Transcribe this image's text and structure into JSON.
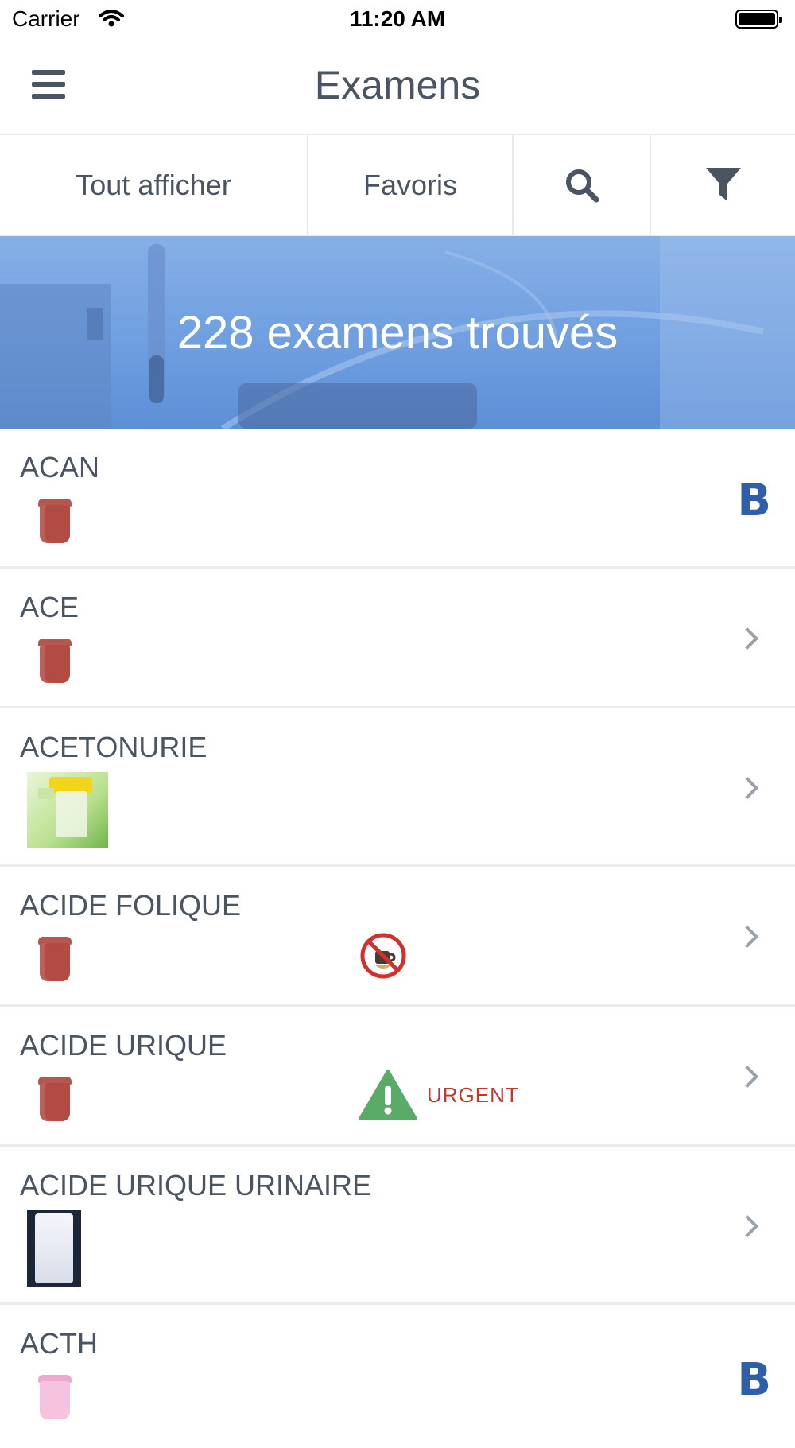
{
  "status_bar": {
    "carrier": "Carrier",
    "time": "11:20 AM"
  },
  "nav": {
    "title": "Examens",
    "menu_icon": "hamburger-menu-icon"
  },
  "toolbar": {
    "show_all_label": "Tout afficher",
    "favorites_label": "Favoris",
    "search_icon": "search-icon",
    "filter_icon": "filter-icon"
  },
  "banner": {
    "title": "228 examens trouvés"
  },
  "list": [
    {
      "name": "ACAN",
      "sample": "red-tube-icon",
      "right": "B"
    },
    {
      "name": "ACE",
      "sample": "red-tube-icon",
      "right": "chevron"
    },
    {
      "name": "ACETONURIE",
      "sample": "urine-cup-image",
      "right": "chevron"
    },
    {
      "name": "ACIDE FOLIQUE",
      "sample": "red-tube-icon",
      "condition": "no-coffee-icon",
      "right": "chevron"
    },
    {
      "name": "ACIDE URIQUE",
      "sample": "red-tube-icon",
      "condition": "warning-icon",
      "condition_label": "URGENT",
      "right": "chevron"
    },
    {
      "name": "ACIDE URIQUE URINAIRE",
      "sample": "urine-container-image",
      "right": "chevron"
    },
    {
      "name": "ACTH",
      "sample": "pink-tube-icon",
      "right": "B"
    }
  ],
  "colors": {
    "accent": "#4a5561",
    "banner": "#6f9fe0",
    "badge": "#2e5fa8",
    "tube": "#b24b43",
    "urgent": "#c0392b",
    "warning_green": "#5aab68"
  }
}
